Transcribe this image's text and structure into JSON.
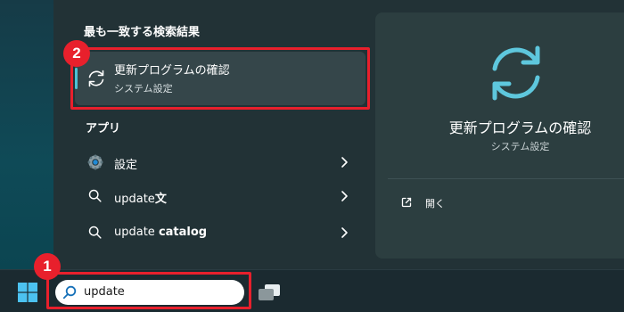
{
  "search_panel": {
    "best_match_heading": "最も一致する検索結果",
    "best_match": {
      "title": "更新プログラムの確認",
      "subtitle": "システム設定",
      "icon": "refresh-icon"
    },
    "apps_heading": "アプリ",
    "apps": [
      {
        "label": "設定",
        "label_bold": "",
        "icon": "gear-icon"
      },
      {
        "label": "update",
        "label_bold": "文",
        "icon": "search-icon"
      },
      {
        "label": "update ",
        "label_bold": "catalog",
        "icon": "search-icon"
      }
    ]
  },
  "detail_pane": {
    "title": "更新プログラムの確認",
    "subtitle": "システム設定",
    "open_label": "開く",
    "icon": "refresh-icon"
  },
  "taskbar": {
    "search_value": "update",
    "start_icon": "windows-logo-icon",
    "taskview_icon": "task-view-icon"
  },
  "annotations": {
    "badge_1": "1",
    "badge_2": "2",
    "color": "#e8202c"
  },
  "colors": {
    "accent": "#4cc2d6",
    "panel": "#223236",
    "selection": "#35464a"
  }
}
